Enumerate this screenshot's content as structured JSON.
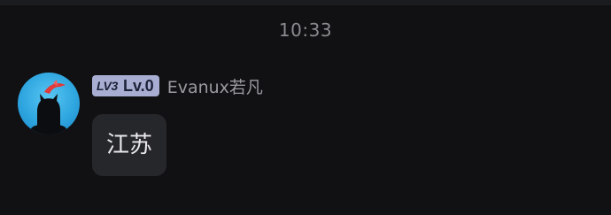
{
  "chat": {
    "timestamp": "10:33",
    "message": {
      "sender": {
        "badge_tag": "LV3",
        "badge_level": "Lv.0",
        "name": "Evanux若凡",
        "avatar_icon": "cat-silhouette-avatar",
        "badge_color": "#a7aed1"
      },
      "text": "江苏"
    }
  }
}
